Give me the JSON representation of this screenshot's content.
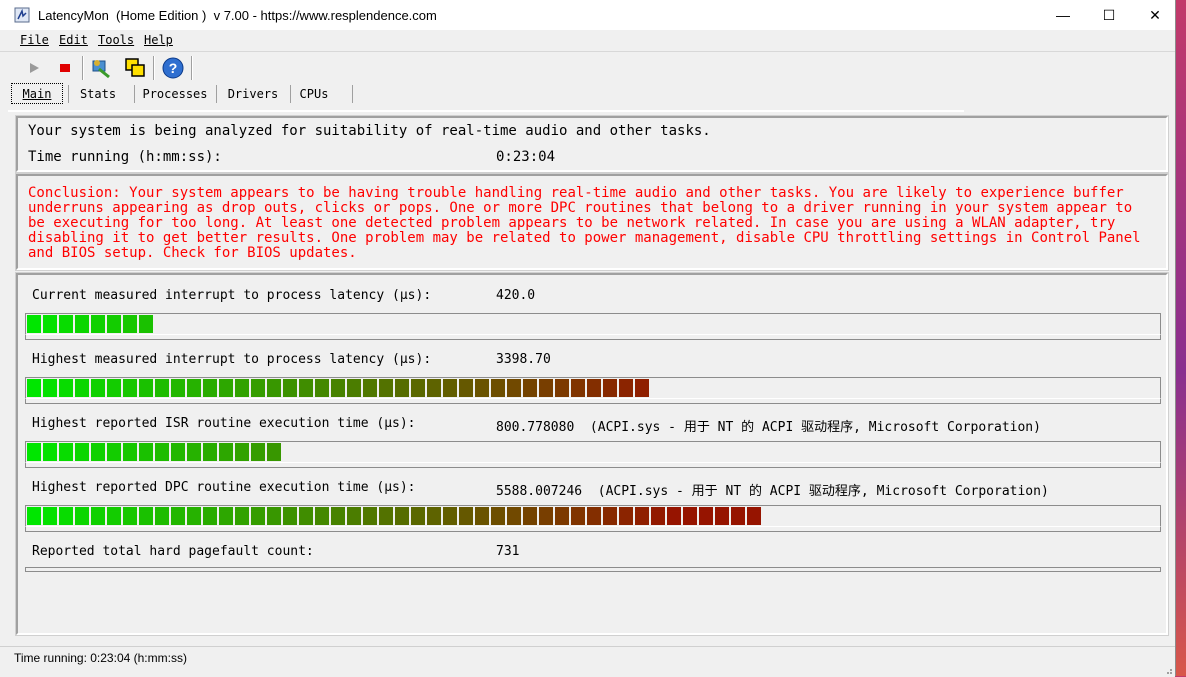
{
  "window": {
    "title": "LatencyMon  (Home Edition )  v 7.00 - https://www.resplendence.com",
    "minimize": "—",
    "maximize": "☐",
    "close": "✕"
  },
  "menu": [
    "File",
    "Edit",
    "Tools",
    "Help"
  ],
  "toolbar": {
    "icons": [
      "play-icon",
      "stop-icon",
      "analyze-tool-icon",
      "windows-icon",
      "help-icon"
    ]
  },
  "tabs": [
    "Main",
    "Stats",
    "Processes",
    "Drivers",
    "CPUs"
  ],
  "status_panel": {
    "line": "Your system is being analyzed for suitability of real-time audio and other tasks.",
    "time_label": "Time running (h:mm:ss):",
    "time_value": "0:23:04"
  },
  "conclusion": "Conclusion: Your system appears to be having trouble handling real-time audio and other tasks. You are likely to experience buffer underruns appearing as drop outs, clicks or pops. One or more DPC routines that belong to a driver running in your system appear to be executing for too long. At least one detected problem appears to be network related. In case you are using a WLAN adapter, try disabling it to get better results. One problem may be related to power management, disable CPU throttling settings in Control Panel and BIOS setup. Check for BIOS updates.",
  "metrics": [
    {
      "label": "Current measured interrupt to process latency (µs):",
      "value": "420.0",
      "fill": 0.11
    },
    {
      "label": "Highest measured interrupt to process latency (µs):",
      "value": "3398.70",
      "fill": 0.55
    },
    {
      "label": "Highest reported ISR routine execution time (µs):",
      "value": "800.778080  (ACPI.sys - 用于 NT 的 ACPI 驱动程序, Microsoft Corporation)",
      "fill": 0.225
    },
    {
      "label": "Highest reported DPC routine execution time (µs):",
      "value": "5588.007246  (ACPI.sys - 用于 NT 的 ACPI 驱动程序, Microsoft Corporation)",
      "fill": 0.65
    },
    {
      "label": "Reported total hard pagefault count:",
      "value": "731"
    }
  ],
  "statusbar": "Time running: 0:23:04  (h:mm:ss)"
}
